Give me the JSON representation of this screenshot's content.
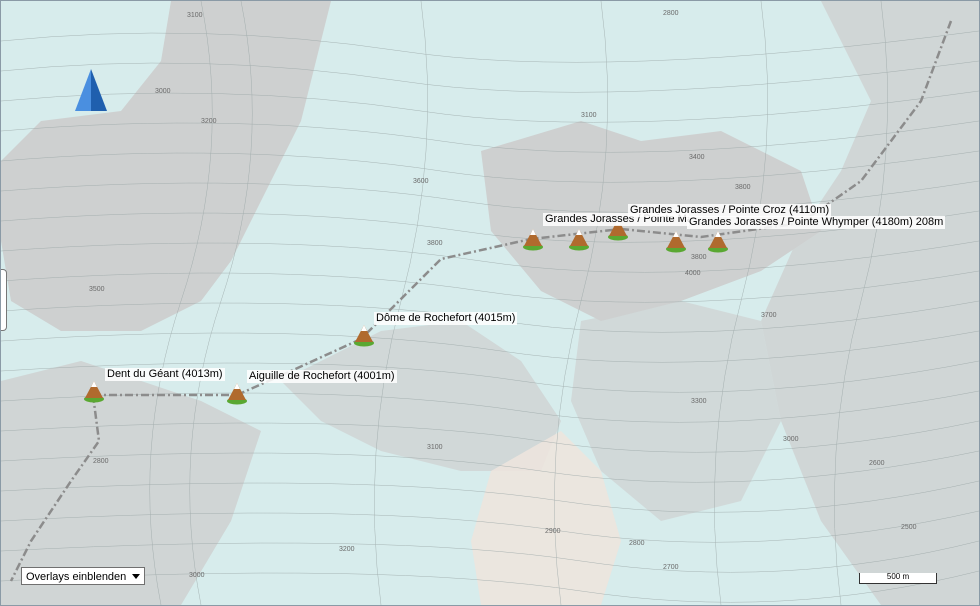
{
  "map": {
    "summits": [
      {
        "name": "Dent du Géant (4013m)",
        "key": "dent"
      },
      {
        "name": "Aiguille de Rochefort (4001m)",
        "key": "aiguille"
      },
      {
        "name": "Dôme de Rochefort (4015m)",
        "key": "dome"
      },
      {
        "name": "Grandes Jorasses / Pointe Mar",
        "key": "pointe_mar"
      },
      {
        "name": "Grandes Jorasses / Pointe Croz (4110m)",
        "key": "croz"
      },
      {
        "name": "Grandes Jorasses / Pointe Whymper (4180m) 208m",
        "key": "whymper"
      }
    ],
    "contour_labels": [
      "3100",
      "3400",
      "3600",
      "2800",
      "3000",
      "3200",
      "3800",
      "3500",
      "3700",
      "3300",
      "4000",
      "2900",
      "2700",
      "2600",
      "2500"
    ]
  },
  "controls": {
    "overlay_label": "Overlays einblenden",
    "scale_label": "500 m"
  },
  "colors": {
    "glacier": "#d7ecec",
    "rock": "#cfcfcf",
    "route": "#8c8c8c",
    "summit_fill": "#b06a2e",
    "summit_base": "#5aa832",
    "north_arrow": "#2d6fc1"
  },
  "icons": [
    "mountain-summit-icon",
    "north-arrow-icon",
    "dropdown-arrow-icon"
  ]
}
